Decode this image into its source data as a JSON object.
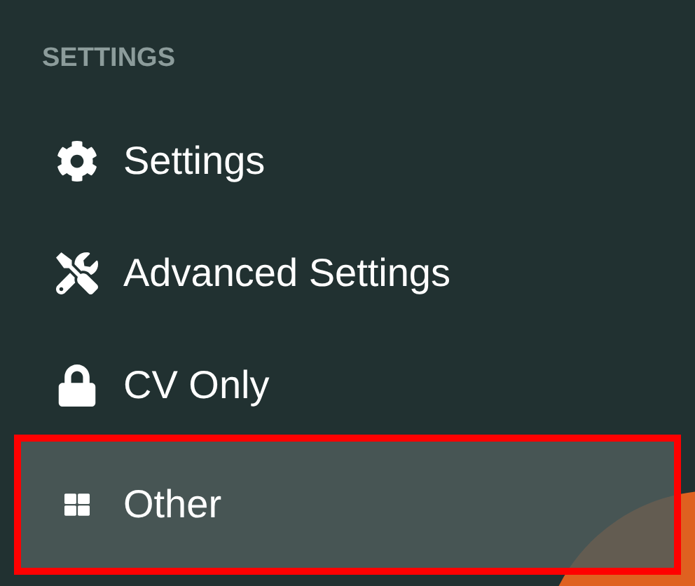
{
  "sidebar": {
    "heading": "SETTINGS",
    "items": [
      {
        "label": "Settings",
        "selected": false
      },
      {
        "label": "Advanced Settings",
        "selected": false
      },
      {
        "label": "CV Only",
        "selected": false
      },
      {
        "label": "Other",
        "selected": true
      }
    ]
  }
}
